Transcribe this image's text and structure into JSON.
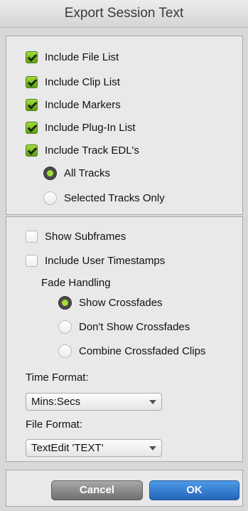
{
  "dialog": {
    "title": "Export Session Text"
  },
  "include": {
    "file_list": {
      "label": "Include File List",
      "checked": true
    },
    "clip_list": {
      "label": "Include Clip List",
      "checked": true
    },
    "markers": {
      "label": "Include Markers",
      "checked": true
    },
    "plugin_list": {
      "label": "Include Plug-In List",
      "checked": true
    },
    "track_edls": {
      "label": "Include Track EDL's",
      "checked": true
    }
  },
  "tracks": {
    "all": {
      "label": "All Tracks",
      "selected": true
    },
    "selected_only": {
      "label": "Selected Tracks Only",
      "selected": false
    }
  },
  "options": {
    "show_subframes": {
      "label": "Show Subframes",
      "checked": false
    },
    "user_timestamps": {
      "label": "Include User Timestamps",
      "checked": false
    }
  },
  "fade_handling": {
    "label": "Fade Handling",
    "show": {
      "label": "Show Crossfades",
      "selected": true
    },
    "dont_show": {
      "label": "Don't Show Crossfades",
      "selected": false
    },
    "combine": {
      "label": "Combine Crossfaded Clips",
      "selected": false
    }
  },
  "time_format": {
    "label": "Time Format:",
    "value": "Mins:Secs"
  },
  "file_format": {
    "label": "File Format:",
    "value": "TextEdit 'TEXT'"
  },
  "buttons": {
    "cancel": "Cancel",
    "ok": "OK"
  },
  "colors": {
    "accent_green": "#8fcc2e",
    "ok_blue": "#2f7ad0"
  }
}
